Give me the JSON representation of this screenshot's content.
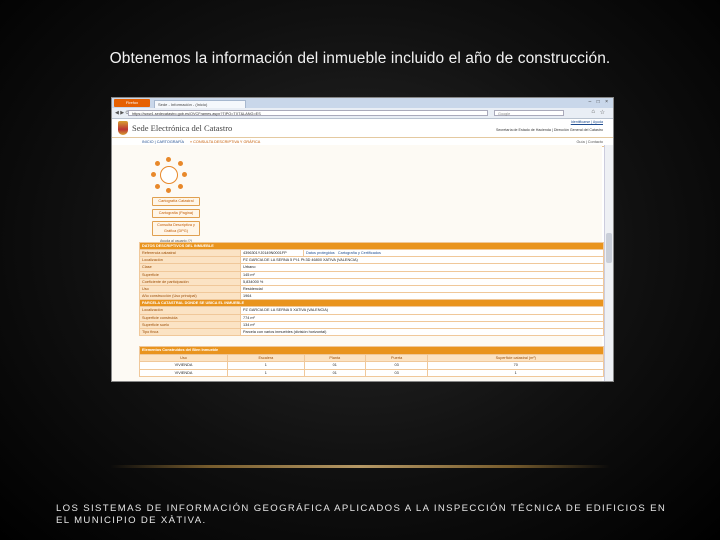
{
  "slide": {
    "title": "Obtenemos la información del inmueble incluido el año de construcción.",
    "footer": "LOS SISTEMAS DE INFORMACIÓN GEOGRÁFICA APLICADOS A LA INSPECCIÓN TÉCNICA DE EDIFICIOS EN EL MUNICIPIO DE XÀTIVA."
  },
  "browser": {
    "app_button": "Firefox",
    "tab_title": "Sede - Información - (Inicio)",
    "window_controls": "– □ ×",
    "url": "https://www1.sedecatastro.gob.es/OVCFrames.aspx?TIPO=TXT&LANG=ES",
    "search_placeholder": "Google",
    "nav_icons": "◀ ▶ ⟳"
  },
  "site": {
    "title": "Sede Electrónica del Catastro",
    "user_link": "Identificarse | Ayuda",
    "ministry": "Secretaría de Estado de Hacienda | Dirección General del Catastro",
    "nav_home": "INICIO | CARTOGRAFÍA",
    "nav_crumb": "» CONSULTA DESCRIPTIVA Y GRÁFICA",
    "nav_right": "Guía | Contacto"
  },
  "map_buttons": [
    {
      "label": "Cartografía Catastral"
    },
    {
      "label": "Cartografía (Pagina)"
    },
    {
      "label": "Consulta Descriptiva y Gráfica (DPG)"
    }
  ],
  "help_link": "Ayuda al usuario (?)",
  "compass_label": "Vista Plano",
  "property": {
    "section_title": "DATOS DESCRIPTIVOS DEL INMUEBLE",
    "rows": [
      {
        "label": "Referencia catastral",
        "value": "4396301YJ0149N0001FP",
        "extra1": "Datos protegidos",
        "extra2": "Cartografía y Certificados"
      },
      {
        "label": "Localización",
        "value": "PZ GARCIA DE LA SERNA 5 Pl:1 Pt:3D 46800 XATIVA (VALENCIA)"
      },
      {
        "label": "Clase",
        "value": "Urbano"
      },
      {
        "label": "Superficie",
        "value": "145 m²"
      },
      {
        "label": "Coeficiente de participación",
        "value": "5,834000 %"
      },
      {
        "label": "Uso",
        "value": "Residencial"
      },
      {
        "label": "Año construcción (Uso principal)",
        "value": "1964"
      }
    ]
  },
  "finca": {
    "section_title": "PARCELA CATASTRAL DONDE SE UBICA EL INMUEBLE",
    "rows": [
      {
        "label": "Localización",
        "value": "PZ GARCIA DE LA SERNA 5 XATIVA (VALENCIA)"
      },
      {
        "label": "Superficie construida",
        "value": "774 m²"
      },
      {
        "label": "Superficie suelo",
        "value": "134 m²"
      },
      {
        "label": "Tipo finca",
        "value": "Parcela con varios inmuebles (división horizontal)"
      }
    ]
  },
  "construction": {
    "section_title": "Elementos Construidos del Bien Inmueble",
    "headers": [
      "Uso",
      "Escalera",
      "Planta",
      "Puerta",
      "Superficie catastral (m²)"
    ],
    "rows": [
      [
        "VIVIENDA",
        "1",
        "01",
        "03",
        "70"
      ],
      [
        "VIVIENDA",
        "1",
        "01",
        "03",
        "1"
      ]
    ]
  }
}
